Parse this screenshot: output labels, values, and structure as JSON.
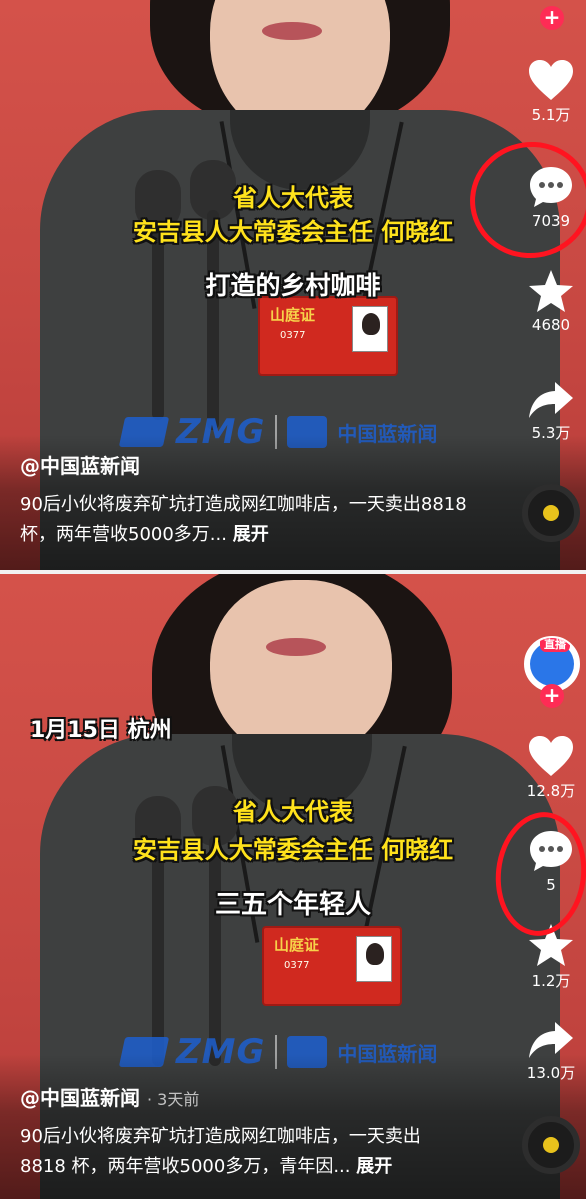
{
  "panel1": {
    "subtitle_line1": "省人大代表",
    "subtitle_line2": "安吉县人大常委会主任 何晓红",
    "subtitle_line3": "打造的乡村咖啡",
    "badge_title": "山庭证",
    "badge_number": "0377",
    "logo_left": "ZMG",
    "logo_right": "中国蓝新闻",
    "author": "@中国蓝新闻",
    "caption": "90后小伙将废弃矿坑打造成网红咖啡店，一天卖出8818 杯，两年营收5000多万...",
    "expand": "展开",
    "likes": "5.1万",
    "comments": "7039",
    "favorites": "4680",
    "shares": "5.3万"
  },
  "panel2": {
    "date_location": "1月15日 杭州",
    "subtitle_line1": "省人大代表",
    "subtitle_line2": "安吉县人大常委会主任 何晓红",
    "subtitle_line3": "三五个年轻人",
    "badge_title": "山庭证",
    "badge_number": "0377",
    "logo_left": "ZMG",
    "logo_right": "中国蓝新闻",
    "author": "@中国蓝新闻",
    "time_ago": "· 3天前",
    "caption": "90后小伙将废弃矿坑打造成网红咖啡店，一天卖出8818 杯，两年营收5000多万，青年因...",
    "expand": "展开",
    "avatar_live": "直播",
    "likes": "12.8万",
    "comments": "5",
    "favorites": "1.2万",
    "shares": "13.0万"
  },
  "icons": [
    "heart-icon",
    "comment-icon",
    "star-icon",
    "share-icon",
    "music-disc-icon",
    "plus-icon"
  ],
  "colors": {
    "background": "#c74842",
    "subtitle_yellow": "#ffe21c",
    "annotation_red": "#ff1420",
    "follow_pink": "#fe2c55",
    "logo_blue": "#1e5fcf"
  }
}
